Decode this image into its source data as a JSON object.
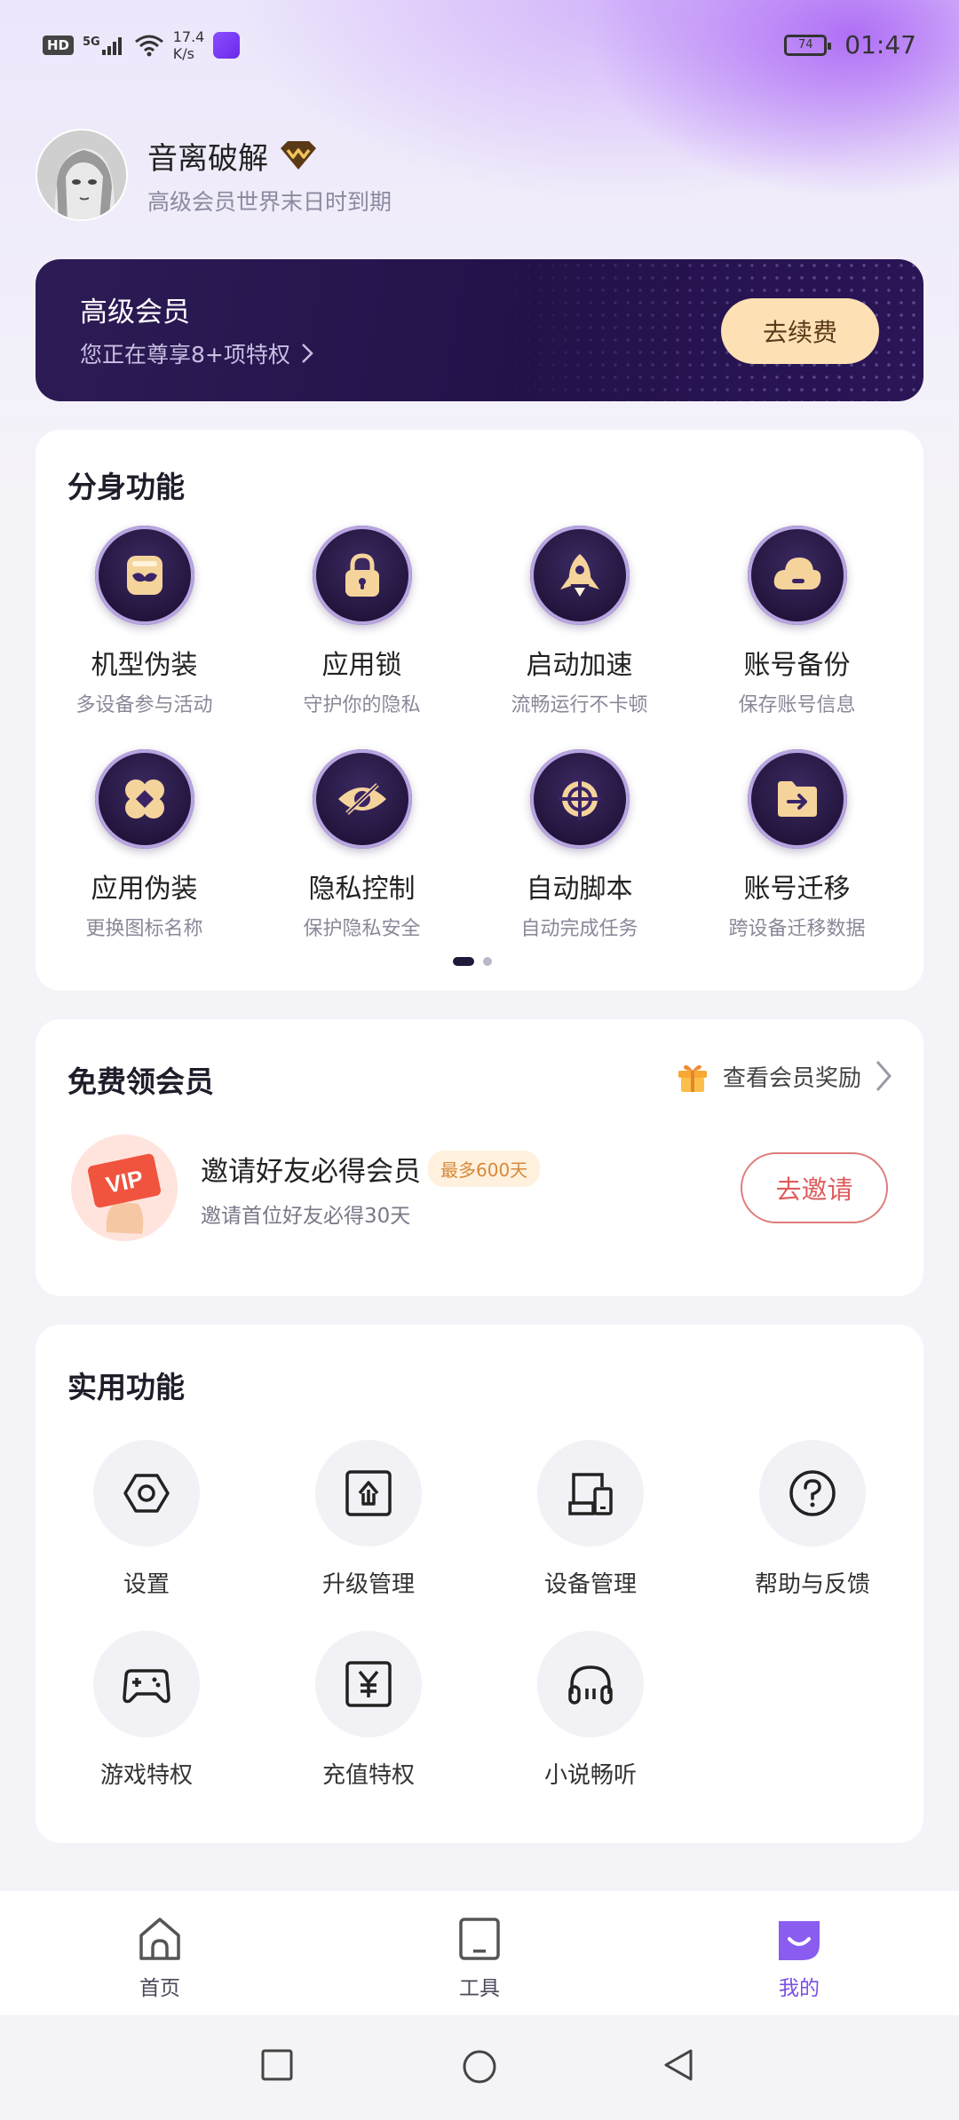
{
  "status_bar": {
    "hd": "HD",
    "signal": "5G",
    "speed_value": "17.4",
    "speed_unit": "K/s",
    "battery": "74",
    "time": "01:47"
  },
  "profile": {
    "username": "音离破解",
    "expiry": "高级会员世界末日时到期"
  },
  "vip_card": {
    "title": "高级会员",
    "subtitle": "您正在尊享8+项特权",
    "renew_label": "去续费"
  },
  "clone_features": {
    "title": "分身功能",
    "items": [
      {
        "label": "机型伪装",
        "sub": "多设备参与活动",
        "icon": "mask-icon"
      },
      {
        "label": "应用锁",
        "sub": "守护你的隐私",
        "icon": "lock-icon"
      },
      {
        "label": "启动加速",
        "sub": "流畅运行不卡顿",
        "icon": "rocket-icon"
      },
      {
        "label": "账号备份",
        "sub": "保存账号信息",
        "icon": "cloud-icon"
      },
      {
        "label": "应用伪装",
        "sub": "更换图标名称",
        "icon": "clover-icon"
      },
      {
        "label": "隐私控制",
        "sub": "保护隐私安全",
        "icon": "eye-slash-icon"
      },
      {
        "label": "自动脚本",
        "sub": "自动完成任务",
        "icon": "crosshair-icon"
      },
      {
        "label": "账号迁移",
        "sub": "跨设备迁移数据",
        "icon": "folder-transfer-icon"
      }
    ],
    "page_count": 2,
    "active_page": 1
  },
  "free_vip": {
    "title": "免费领会员",
    "rewards_link": "查看会员奖励",
    "invite_title": "邀请好友必得会员",
    "invite_badge": "最多600天",
    "invite_sub": "邀请首位好友必得30天",
    "invite_button": "去邀请",
    "vip_img_text": "VIP"
  },
  "tools": {
    "title": "实用功能",
    "items": [
      {
        "label": "设置",
        "icon": "settings-icon"
      },
      {
        "label": "升级管理",
        "icon": "upgrade-icon"
      },
      {
        "label": "设备管理",
        "icon": "device-icon"
      },
      {
        "label": "帮助与反馈",
        "icon": "help-icon"
      },
      {
        "label": "游戏特权",
        "icon": "gamepad-icon"
      },
      {
        "label": "充值特权",
        "icon": "recharge-icon"
      },
      {
        "label": "小说畅听",
        "icon": "headphones-icon"
      }
    ]
  },
  "bottom_nav": {
    "items": [
      {
        "label": "首页",
        "icon": "home-icon"
      },
      {
        "label": "工具",
        "icon": "tools-icon"
      },
      {
        "label": "我的",
        "icon": "mine-icon",
        "active": true
      }
    ],
    "active_color": "#7a4ee6"
  },
  "colors": {
    "vip_card_bg": "#2d1b55",
    "renew_button": "#fde0b4",
    "invite_border": "#e07b7b"
  }
}
